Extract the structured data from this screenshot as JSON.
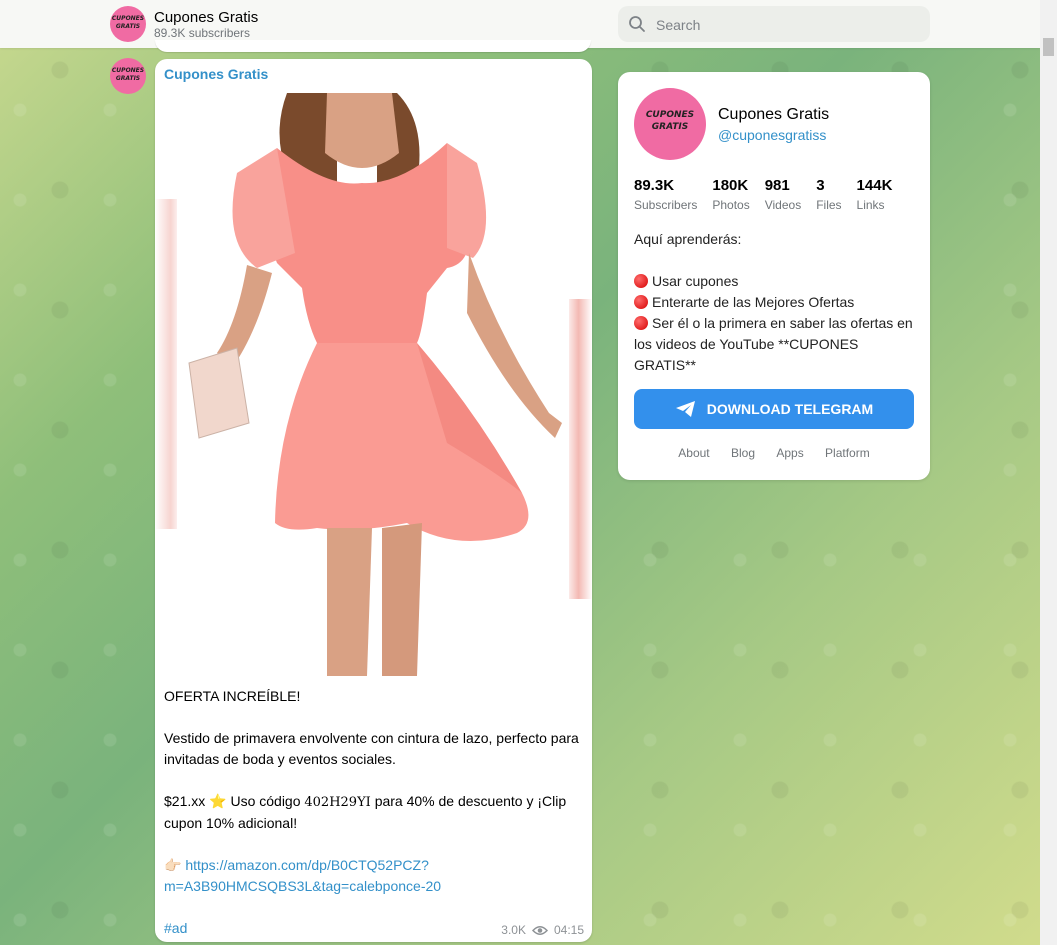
{
  "header": {
    "channel_name": "Cupones Gratis",
    "subscribers": "89.3K subscribers",
    "search_placeholder": "Search"
  },
  "avatar": {
    "line1": "CUPONES",
    "line2": "GRATIS"
  },
  "message": {
    "author": "Cupones Gratis",
    "lines": [
      "OFERTA INCREÍBLE!",
      "",
      "Vestido de primavera envolvente con cintura de lazo, perfecto para invitadas de boda y eventos sociales.",
      ""
    ],
    "price_prefix": "$21.xx ⭐ Uso código ",
    "code": "402H29YI",
    "price_suffix": " para 40% de descuento y ¡Clip cupon 10% adicional!",
    "link_emoji": "👉🏻",
    "link": "https://amazon.com/dp/B0CTQ52PCZ?m=A3B90HMCSQBS3L&tag=calebponce-20",
    "hashtag": "#ad",
    "views": "3.0K",
    "time": "04:15"
  },
  "card": {
    "name": "Cupones Gratis",
    "handle": "@cuponesgratiss",
    "stats": [
      {
        "value": "89.3K",
        "label": "Subscribers"
      },
      {
        "value": "180K",
        "label": "Photos"
      },
      {
        "value": "981",
        "label": "Videos"
      },
      {
        "value": "3",
        "label": "Files"
      },
      {
        "value": "144K",
        "label": "Links"
      }
    ],
    "description_intro": "Aquí aprenderás:",
    "bullets": [
      "Usar cupones",
      "Enterarte de las Mejores Ofertas",
      "Ser él o la primera en saber las ofertas en los videos de YouTube **CUPONES GRATIS**"
    ],
    "download_label": "DOWNLOAD TELEGRAM",
    "footer_links": [
      "About",
      "Blog",
      "Apps",
      "Platform"
    ]
  },
  "colors": {
    "accent": "#3390c9",
    "button": "#3390ec",
    "avatar_bg": "#f06ba3"
  }
}
